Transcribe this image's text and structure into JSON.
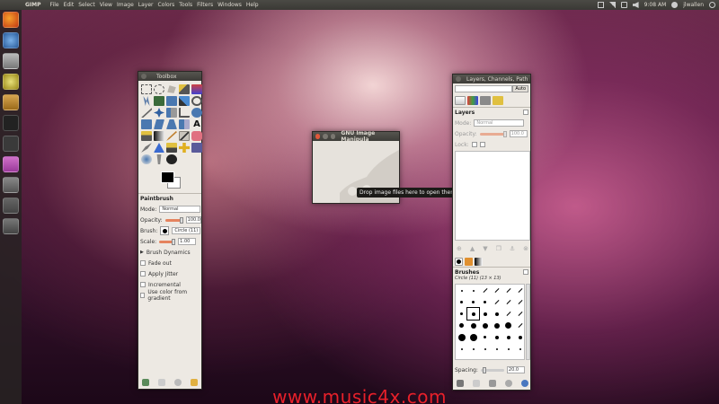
{
  "top_panel": {
    "app_name": "GIMP",
    "menus": [
      "File",
      "Edit",
      "Select",
      "View",
      "Image",
      "Layer",
      "Colors",
      "Tools",
      "Filters",
      "Windows",
      "Help"
    ],
    "clock": "9:08 AM",
    "user": "jlwallen"
  },
  "toolbox": {
    "title": "Toolbox",
    "tool_options_title": "Paintbrush",
    "mode_label": "Mode:",
    "mode_value": "Normal",
    "opacity_label": "Opacity:",
    "opacity_value": "100.0",
    "brush_label": "Brush:",
    "brush_value": "Circle (11)",
    "scale_label": "Scale:",
    "scale_value": "1.00",
    "brush_dynamics": "Brush Dynamics",
    "options": [
      "Fade out",
      "Apply Jitter",
      "Incremental",
      "Use color from gradient"
    ],
    "fg_color": "#000000",
    "bg_color": "#ffffff"
  },
  "image_window": {
    "title": "GNU Image Manipula",
    "tooltip": "Drop image files here to open them"
  },
  "layers_dock": {
    "title": "Layers, Channels, Path",
    "auto_button": "Auto",
    "layers_title": "Layers",
    "mode_label": "Mode:",
    "mode_value": "Normal",
    "opacity_label": "Opacity:",
    "opacity_value": "100.0",
    "lock_label": "Lock:",
    "brushes_title": "Brushes",
    "brush_name": "Circle (11) (13 × 13)",
    "spacing_label": "Spacing:",
    "spacing_value": "20.0"
  },
  "watermark": "www.music4x.com"
}
